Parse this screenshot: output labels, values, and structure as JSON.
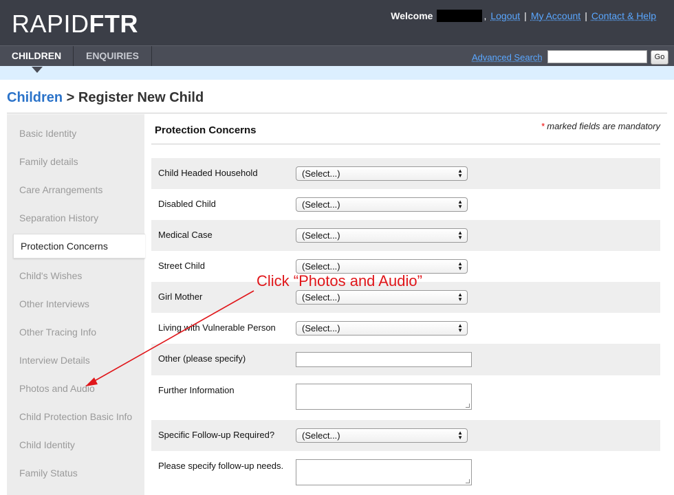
{
  "app": {
    "logo_light": "RAPID",
    "logo_bold": "FTR"
  },
  "userbar": {
    "welcome": "Welcome",
    "comma": ",",
    "logout": "Logout",
    "my_account": "My Account",
    "contact_help": "Contact & Help",
    "separator": "|"
  },
  "nav": {
    "tabs": [
      {
        "label": "CHILDREN",
        "active": true
      },
      {
        "label": "ENQUIRIES",
        "active": false
      }
    ],
    "advanced_search": "Advanced Search",
    "search_value": "",
    "go_label": "Go"
  },
  "breadcrumb": {
    "root": "Children",
    "separator": " > ",
    "current": "Register New Child"
  },
  "sidebar": {
    "items": [
      {
        "label": "Basic Identity"
      },
      {
        "label": "Family details"
      },
      {
        "label": "Care Arrangements"
      },
      {
        "label": "Separation History"
      },
      {
        "label": "Protection Concerns",
        "active": true
      },
      {
        "label": "Child's Wishes"
      },
      {
        "label": "Other Interviews"
      },
      {
        "label": "Other Tracing Info"
      },
      {
        "label": "Interview Details"
      },
      {
        "label": "Photos and Audio"
      },
      {
        "label": "Child Protection Basic Info"
      },
      {
        "label": "Child Identity"
      },
      {
        "label": "Family Status"
      }
    ]
  },
  "form": {
    "section_title": "Protection Concerns",
    "mandatory_star": "*",
    "mandatory_note": " marked fields are mandatory",
    "select_placeholder": "(Select...)",
    "fields": [
      {
        "label": "Child Headed Household",
        "type": "select",
        "value": "(Select...)"
      },
      {
        "label": "Disabled Child",
        "type": "select",
        "value": "(Select...)"
      },
      {
        "label": "Medical Case",
        "type": "select",
        "value": "(Select...)"
      },
      {
        "label": "Street Child",
        "type": "select",
        "value": "(Select...)"
      },
      {
        "label": "Girl Mother",
        "type": "select",
        "value": "(Select...)"
      },
      {
        "label": "Living with Vulnerable Person",
        "type": "select",
        "value": "(Select...)"
      },
      {
        "label": "Other (please specify)",
        "type": "text",
        "value": ""
      },
      {
        "label": "Further Information",
        "type": "textarea",
        "value": ""
      },
      {
        "label": "Specific Follow-up Required?",
        "type": "select",
        "value": "(Select...)"
      },
      {
        "label": "Please specify follow-up needs.",
        "type": "textarea",
        "value": ""
      }
    ]
  },
  "annotation": {
    "text": "Click “Photos and Audio”",
    "color": "#e0161a"
  },
  "colors": {
    "header_bg": "#3b3e47",
    "link_blue": "#5aa7ff",
    "breadcrumb_blue": "#2b73c9",
    "strip_bg": "#dcefff"
  }
}
